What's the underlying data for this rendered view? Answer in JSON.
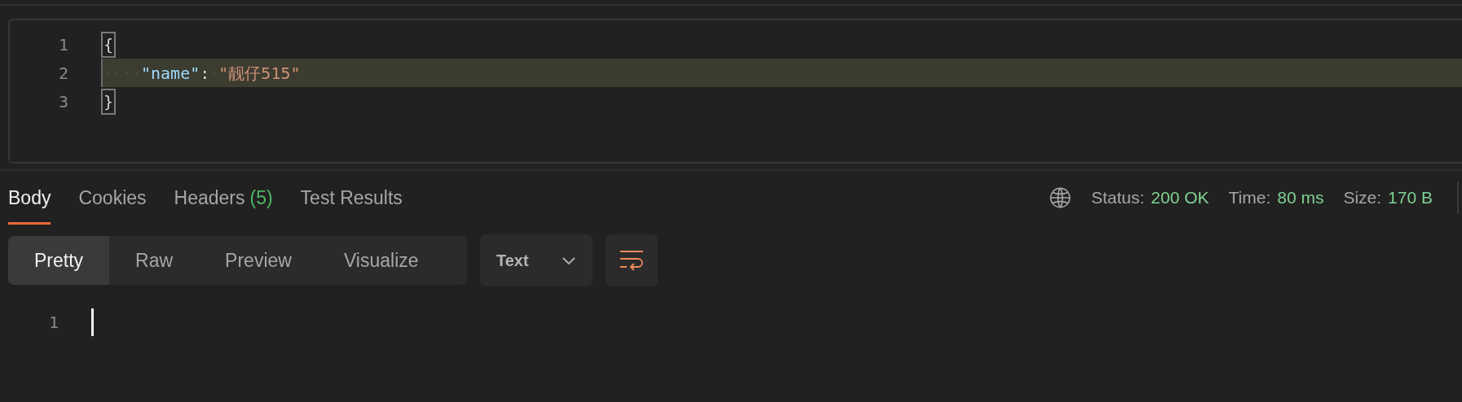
{
  "request_editor": {
    "lines": [
      {
        "number": "1",
        "highlighted": false,
        "tokens": [
          {
            "kind": "brace",
            "text": "{"
          }
        ]
      },
      {
        "number": "2",
        "highlighted": true,
        "tokens": [
          {
            "kind": "indent"
          },
          {
            "kind": "key",
            "text": "\"name\""
          },
          {
            "kind": "punct",
            "text": ":"
          },
          {
            "kind": "space"
          },
          {
            "kind": "string",
            "text": "\"靓仔515\""
          }
        ]
      },
      {
        "number": "3",
        "highlighted": false,
        "tokens": [
          {
            "kind": "brace",
            "text": "}"
          }
        ]
      }
    ]
  },
  "response_tabs": [
    {
      "label": "Body",
      "selected": true
    },
    {
      "label": "Cookies",
      "selected": false
    },
    {
      "label": "Headers",
      "count": "(5)",
      "selected": false
    },
    {
      "label": "Test Results",
      "selected": false
    }
  ],
  "status": [
    {
      "label": "Status:",
      "value": "200 OK"
    },
    {
      "label": "Time:",
      "value": "80 ms"
    },
    {
      "label": "Size:",
      "value": "170 B"
    }
  ],
  "view_modes": [
    {
      "label": "Pretty",
      "selected": true
    },
    {
      "label": "Raw",
      "selected": false
    },
    {
      "label": "Preview",
      "selected": false
    },
    {
      "label": "Visualize",
      "selected": false
    }
  ],
  "format_dropdown": {
    "value": "Text"
  },
  "response_body": {
    "lines": [
      {
        "number": "1"
      }
    ]
  }
}
